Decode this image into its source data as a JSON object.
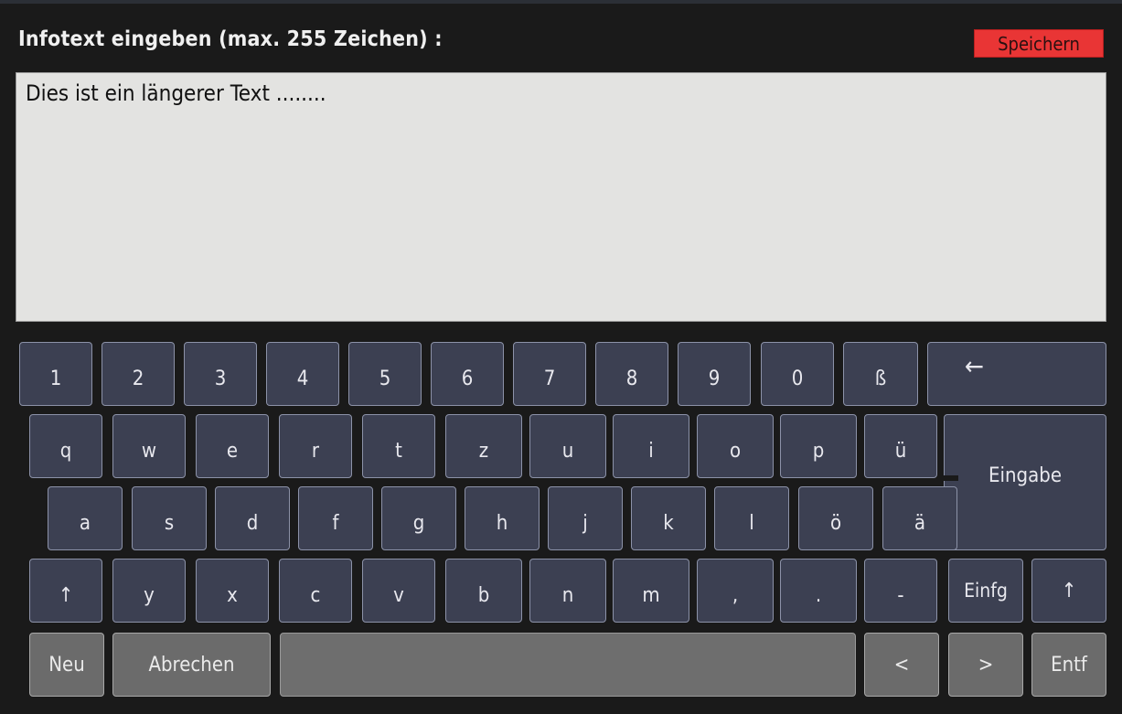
{
  "header": {
    "title": "Infotext eingeben (max. 255 Zeichen) :",
    "save_label": "Speichern"
  },
  "editor": {
    "value": "Dies ist ein längerer Text ........"
  },
  "keyboard": {
    "row1": [
      "1",
      "2",
      "3",
      "4",
      "5",
      "6",
      "7",
      "8",
      "9",
      "0",
      "ß",
      "←"
    ],
    "row2": [
      "q",
      "w",
      "e",
      "r",
      "t",
      "z",
      "u",
      "i",
      "o",
      "p",
      "ü"
    ],
    "enter_label": "Eingabe",
    "row3": [
      "a",
      "s",
      "d",
      "f",
      "g",
      "h",
      "j",
      "k",
      "l",
      "ö",
      "ä"
    ],
    "row4": [
      "↑",
      "y",
      "x",
      "c",
      "v",
      "b",
      "n",
      "m",
      ",",
      ".",
      "-",
      "Einfg",
      "↑"
    ],
    "row5": {
      "new": "Neu",
      "cancel": "Abrechen",
      "space": "",
      "left": "<",
      "right": ">",
      "delete": "Entf"
    }
  },
  "colors": {
    "accent_red": "#e93535",
    "key_bg": "#3c4052",
    "key_gray": "#6b6b6b",
    "editor_bg": "#e3e3e1"
  }
}
